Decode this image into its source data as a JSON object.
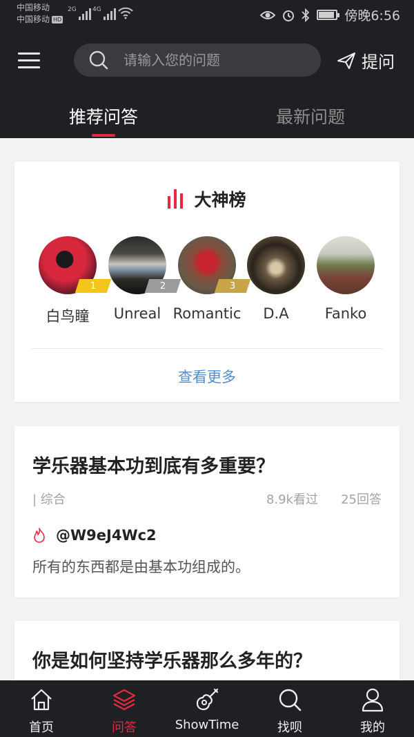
{
  "status_bar": {
    "carrier_1": "中国移动",
    "carrier_2": "中国移动",
    "hd_badge": "HD",
    "net_1": "2G",
    "net_2": "4G",
    "time": "傍晚6:56"
  },
  "header": {
    "search_placeholder": "请输入您的问题",
    "ask_label": "提问",
    "tabs": [
      {
        "label": "推荐问答",
        "active": true
      },
      {
        "label": "最新问题",
        "active": false
      }
    ]
  },
  "leaderboard": {
    "title": "大神榜",
    "users": [
      {
        "name": "白鸟瞳",
        "rank": "1"
      },
      {
        "name": "Unreal",
        "rank": "2"
      },
      {
        "name": "Romantic",
        "rank": "3"
      },
      {
        "name": "D.A",
        "rank": ""
      },
      {
        "name": "Fanko",
        "rank": ""
      }
    ],
    "more_label": "查看更多"
  },
  "questions": [
    {
      "title": "学乐器基本功到底有多重要？",
      "category": "| 综合",
      "views": "8.9k看过",
      "answers": "25回答",
      "author": "@W9eJ4Wc2",
      "excerpt": "所有的东西都是由基本功组成的。"
    },
    {
      "title": "你是如何坚持学乐器那么多年的？"
    }
  ],
  "bottom_nav": [
    {
      "label": "首页",
      "icon": "home-icon",
      "active": false
    },
    {
      "label": "问答",
      "icon": "layers-icon",
      "active": true
    },
    {
      "label": "ShowTime",
      "icon": "guitar-icon",
      "active": false
    },
    {
      "label": "找呗",
      "icon": "search-icon",
      "active": false
    },
    {
      "label": "我的",
      "icon": "user-icon",
      "active": false
    }
  ],
  "colors": {
    "accent": "#e5293e",
    "header_bg": "#1f2024",
    "link": "#4f8fd0",
    "rank_gold": "#f4c51a",
    "rank_silver": "#9b9b9b",
    "rank_bronze": "#c9a54a"
  }
}
